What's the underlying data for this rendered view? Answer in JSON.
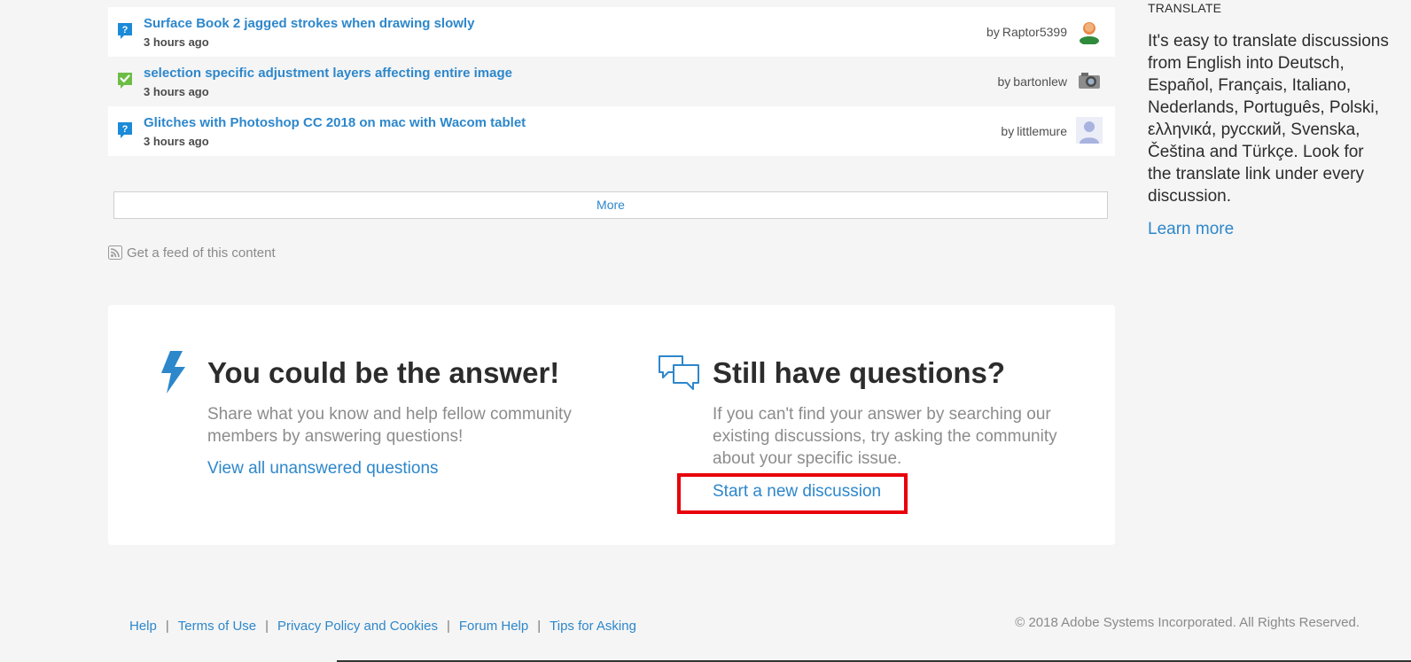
{
  "discussions": [
    {
      "title": "Surface Book 2 jagged strokes when drawing slowly",
      "time": "3 hours ago",
      "author": "Raptor5399",
      "status": "question",
      "avatar": "person"
    },
    {
      "title": "selection specific adjustment layers affecting entire image",
      "time": "3 hours ago",
      "author": "bartonlew",
      "status": "answered",
      "avatar": "camera"
    },
    {
      "title": "Glitches with Photoshop CC 2018 on mac with Wacom tablet",
      "time": "3 hours ago",
      "author": "littlemure",
      "status": "question",
      "avatar": "default"
    }
  ],
  "list": {
    "by_prefix": "by",
    "more_label": "More",
    "feed_label": "Get a feed of this content"
  },
  "callouts": {
    "answer": {
      "heading": "You could be the answer!",
      "body": "Share what you know and help fellow community members by answering questions!",
      "link": "View all unanswered questions"
    },
    "questions": {
      "heading": "Still have questions?",
      "body": "If you can't find your answer by searching our existing discussions, try asking the community about your specific issue.",
      "link": "Start a new discussion"
    }
  },
  "sidebar": {
    "label": "TRANSLATE",
    "body": "It's easy to translate discussions from English into Deutsch, Español, Français, Italiano, Nederlands, Português, Polski, ελληνικά, русский, Svenska, Čeština and Türkçe. Look for the translate link under every discussion.",
    "learn_more": "Learn more"
  },
  "footer": {
    "links": [
      "Help",
      "Terms of Use",
      "Privacy Policy and Cookies",
      "Forum Help",
      "Tips for Asking"
    ],
    "copyright": "© 2018 Adobe Systems Incorporated. All Rights Reserved."
  },
  "colors": {
    "link": "#2d87cb",
    "question_icon": "#1b8ad8",
    "answered_icon": "#6cbd45",
    "highlight_box": "#e8000b"
  }
}
